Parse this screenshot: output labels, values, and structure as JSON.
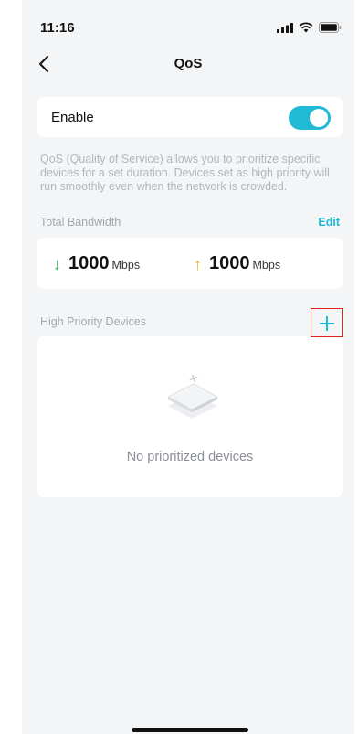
{
  "status_bar": {
    "time": "11:16"
  },
  "nav": {
    "title": "QoS"
  },
  "enable": {
    "label": "Enable",
    "state": "on"
  },
  "description": "QoS (Quality of Service) allows you to prioritize specific devices for a set duration. Devices set as high priority will run smoothly even when the network is crowded.",
  "bandwidth": {
    "section_label": "Total Bandwidth",
    "edit_label": "Edit",
    "download": {
      "value": "1000",
      "unit": "Mbps",
      "arrow": "↓"
    },
    "upload": {
      "value": "1000",
      "unit": "Mbps",
      "arrow": "↑"
    }
  },
  "devices": {
    "section_label": "High Priority Devices",
    "empty_text": "No prioritized devices"
  },
  "colors": {
    "accent": "#20b9d6",
    "download_arrow": "#2bb34a",
    "upload_arrow": "#f5a623",
    "highlight_border": "#e0231d"
  }
}
